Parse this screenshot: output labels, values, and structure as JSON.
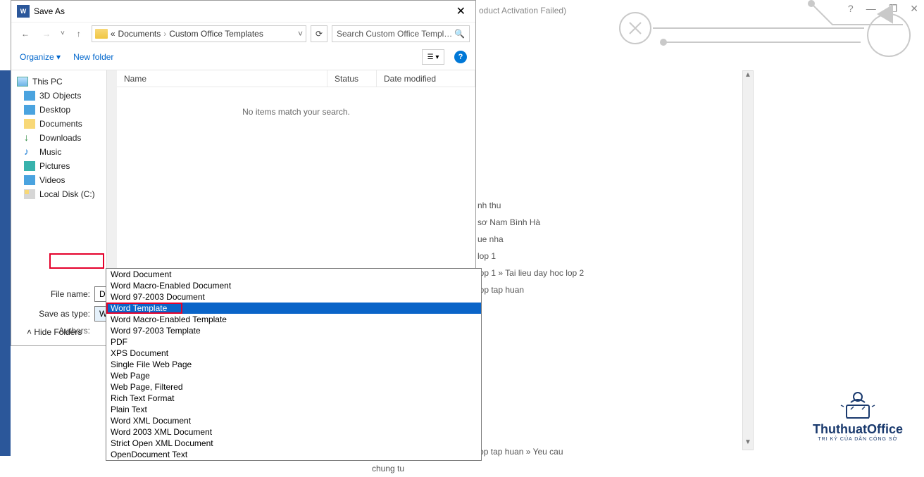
{
  "bg": {
    "activation": "oduct Activation Failed)",
    "help": "?",
    "restore": "❐",
    "close": "✕",
    "items": [
      "nh thu",
      "sơ Nam Bình Hà",
      "ue nha",
      "lop 1",
      "lop 1 » Tai lieu day hoc lop 2",
      "lop tap huan",
      "Documents » May tinh » 12 lop tap huan » Yeu cau chung tu"
    ]
  },
  "dialog": {
    "title": "Save As",
    "nav": {
      "crumb_prefix": "«",
      "crumb1": "Documents",
      "crumb2": "Custom Office Templates",
      "search_placeholder": "Search Custom Office Templa...",
      "organize": "Organize ▾",
      "new_folder": "New folder",
      "view": "☰ ▾",
      "help": "?"
    },
    "navpane": [
      {
        "icon": "ico-pc",
        "label": "This PC",
        "root": true
      },
      {
        "icon": "ico-3d",
        "label": "3D Objects"
      },
      {
        "icon": "ico-desk",
        "label": "Desktop"
      },
      {
        "icon": "ico-docs",
        "label": "Documents"
      },
      {
        "icon": "ico-down",
        "glyph": "↓",
        "label": "Downloads"
      },
      {
        "icon": "ico-music",
        "glyph": "♪",
        "label": "Music"
      },
      {
        "icon": "ico-pic",
        "label": "Pictures"
      },
      {
        "icon": "ico-vid",
        "label": "Videos"
      },
      {
        "icon": "ico-disk",
        "label": "Local Disk (C:)"
      }
    ],
    "cols": {
      "name": "Name",
      "status": "Status",
      "date": "Date modified"
    },
    "empty": "No items match your search.",
    "filename_label": "File name:",
    "filename": "Doc1",
    "type_label": "Save as type:",
    "type_value": "Word Template",
    "authors_label": "Authors:",
    "hide": "Hide Folders",
    "dropdown": [
      "Word Document",
      "Word Macro-Enabled Document",
      "Word 97-2003 Document",
      "Word Template",
      "Word Macro-Enabled Template",
      "Word 97-2003 Template",
      "PDF",
      "XPS Document",
      "Single File Web Page",
      "Web Page",
      "Web Page, Filtered",
      "Rich Text Format",
      "Plain Text",
      "Word XML Document",
      "Word 2003 XML Document",
      "Strict Open XML Document",
      "OpenDocument Text"
    ],
    "dd_selected_index": 3
  },
  "watermark": {
    "name": "ThuthuatOffice",
    "sub": "TRI KỶ CỦA DÂN CÔNG SỞ"
  }
}
